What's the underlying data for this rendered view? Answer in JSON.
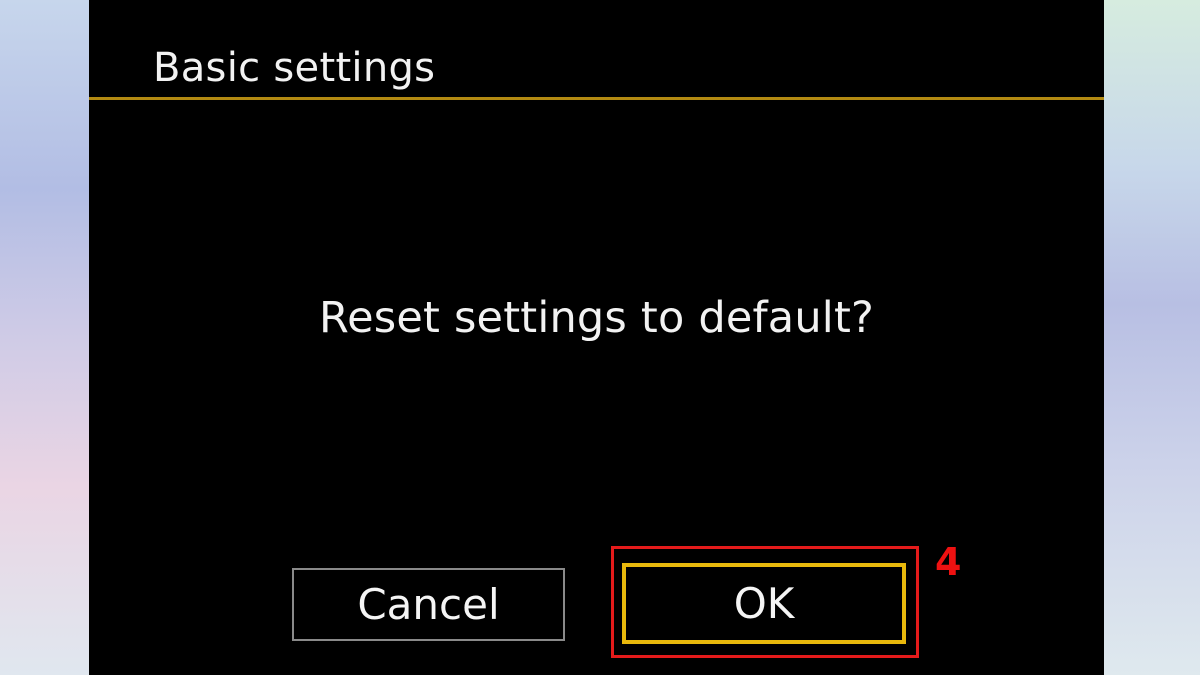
{
  "dialog": {
    "title": "Basic settings",
    "message": "Reset settings to default?",
    "buttons": {
      "cancel_label": "Cancel",
      "ok_label": "OK"
    }
  },
  "annotation": {
    "step_number": "4"
  },
  "colors": {
    "screen_background": "#000000",
    "header_rule": "#b38a12",
    "selected_button_border": "#e8b80c",
    "button_border": "#8a8a8a",
    "annotation_red": "#e51b1b"
  }
}
